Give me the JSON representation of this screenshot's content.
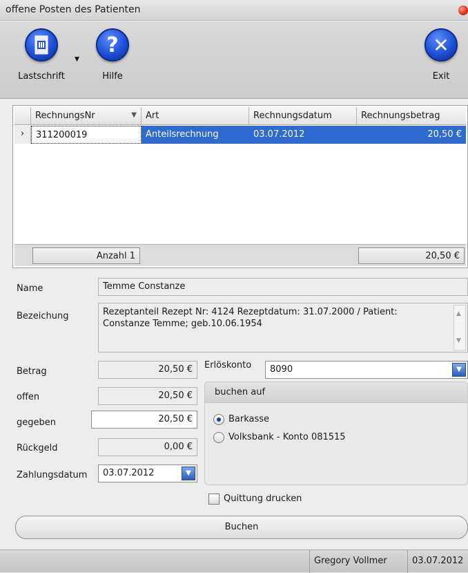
{
  "window": {
    "title": "offene Posten des Patienten"
  },
  "toolbar": {
    "lastschrift_label": "Lastschrift",
    "hilfe_label": "Hilfe",
    "exit_label": "Exit"
  },
  "grid": {
    "columns": [
      "RechnungsNr",
      "Art",
      "Rechnungsdatum",
      "Rechnungsbetrag"
    ],
    "rows": [
      {
        "nr": "311200019",
        "art": "Anteilsrechnung",
        "datum": "03.07.2012",
        "betrag": "20,50 €"
      }
    ],
    "footer": {
      "count": "Anzahl 1",
      "sum": "20,50 €"
    }
  },
  "form": {
    "name_label": "Name",
    "name_value": "Temme Constanze",
    "bezeichnung_label": "Bezeichung",
    "bezeichnung_value": "Rezeptanteil Rezept Nr: 4124 Rezeptdatum: 31.07.2000 / Patient: Constanze Temme; geb.10.06.1954",
    "betrag_label": "Betrag",
    "betrag_value": "20,50 €",
    "offen_label": "offen",
    "offen_value": "20,50 €",
    "gegeben_label": "gegeben",
    "gegeben_value": "20,50 €",
    "rueckgeld_label": "Rückgeld",
    "rueckgeld_value": "0,00 €",
    "zahlungsdatum_label": "Zahlungsdatum",
    "zahlungsdatum_value": "03.07.2012",
    "erloeskonto_label": "Erlöskonto",
    "erloeskonto_value": "8090",
    "buchen_auf_title": "buchen auf",
    "option_barkasse": "Barkasse",
    "option_volksbank": "Volksbank  - Konto 081515",
    "selected_option": "Barkasse",
    "quittung_label": "Quittung drucken",
    "quittung_checked": false,
    "buchen_button": "Buchen"
  },
  "status": {
    "user": "Gregory Vollmer",
    "date": "03.07.2012"
  },
  "colors": {
    "selection": "#2e6bd1",
    "accent_blue": "#1f4fd6"
  }
}
